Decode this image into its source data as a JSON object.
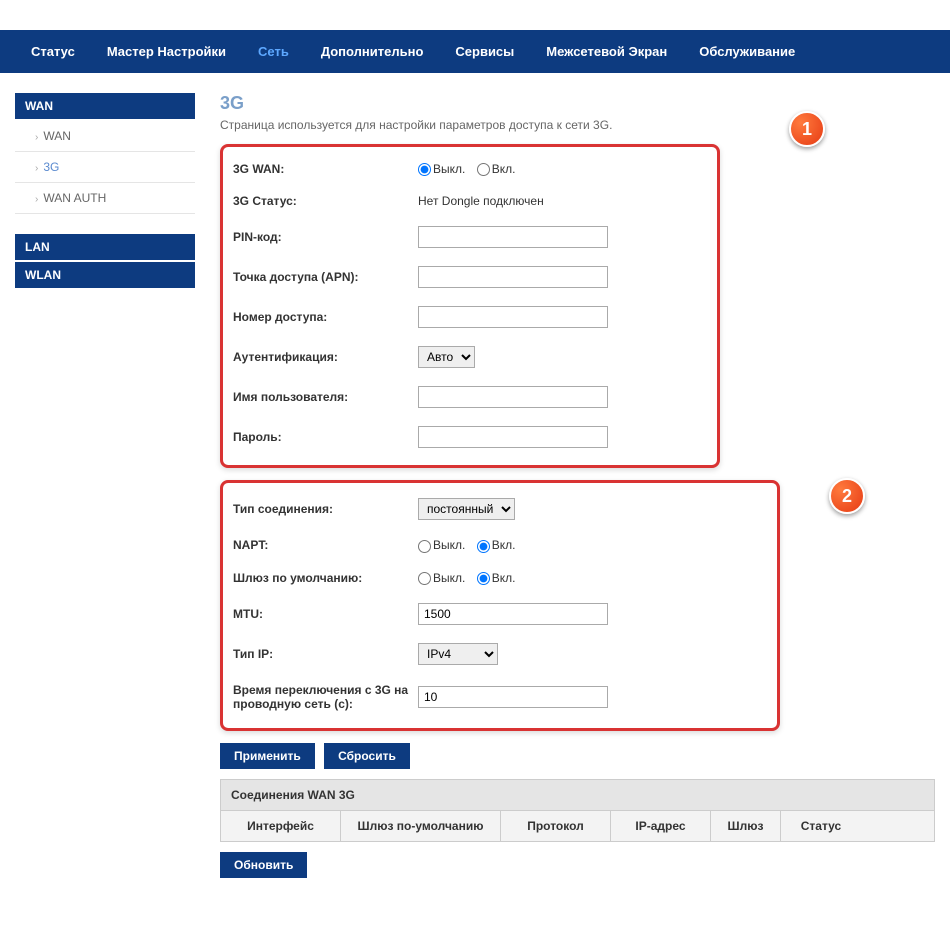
{
  "topnav": {
    "items": [
      {
        "label": "Статус"
      },
      {
        "label": "Мастер Настройки"
      },
      {
        "label": "Сеть",
        "active": true
      },
      {
        "label": "Дополнительно"
      },
      {
        "label": "Сервисы"
      },
      {
        "label": "Межсетевой Экран"
      },
      {
        "label": "Обслуживание"
      }
    ]
  },
  "sidebar": {
    "groups": [
      {
        "header": "WAN",
        "items": [
          {
            "label": "WAN"
          },
          {
            "label": "3G",
            "active": true
          },
          {
            "label": "WAN AUTH"
          }
        ]
      },
      {
        "header": "LAN",
        "items": []
      },
      {
        "header": "WLAN",
        "items": []
      }
    ]
  },
  "page": {
    "title": "3G",
    "subtitle": "Страница используется для настройки параметров доступа к сети 3G."
  },
  "labels": {
    "off": "Выкл.",
    "on": "Вкл."
  },
  "block1": {
    "wan3g_label": "3G WAN:",
    "wan3g_selected": "off",
    "status_label": "3G Статус:",
    "status_value": "Нет Dongle подключен",
    "pin_label": "PIN-код:",
    "pin_value": "",
    "apn_label": "Точка доступа (APN):",
    "apn_value": "",
    "dial_label": "Номер доступа:",
    "dial_value": "",
    "auth_label": "Аутентификация:",
    "auth_value": "Авто",
    "user_label": "Имя пользователя:",
    "user_value": "",
    "pass_label": "Пароль:",
    "pass_value": ""
  },
  "block2": {
    "conn_label": "Тип соединения:",
    "conn_value": "постоянный",
    "napt_label": "NAPT:",
    "napt_selected": "on",
    "gw_label": "Шлюз по умолчанию:",
    "gw_selected": "on",
    "mtu_label": "MTU:",
    "mtu_value": "1500",
    "iptype_label": "Тип IP:",
    "iptype_value": "IPv4",
    "switch_label": "Время переключения с 3G на проводную сеть (c):",
    "switch_value": "10"
  },
  "buttons": {
    "apply": "Применить",
    "reset": "Сбросить",
    "refresh": "Обновить"
  },
  "table": {
    "title": "Соединения WAN 3G",
    "cols": [
      "Интерфейс",
      "Шлюз по-умолчанию",
      "Протокол",
      "IP-адрес",
      "Шлюз",
      "Статус"
    ]
  },
  "badges": {
    "b1": "1",
    "b2": "2"
  }
}
